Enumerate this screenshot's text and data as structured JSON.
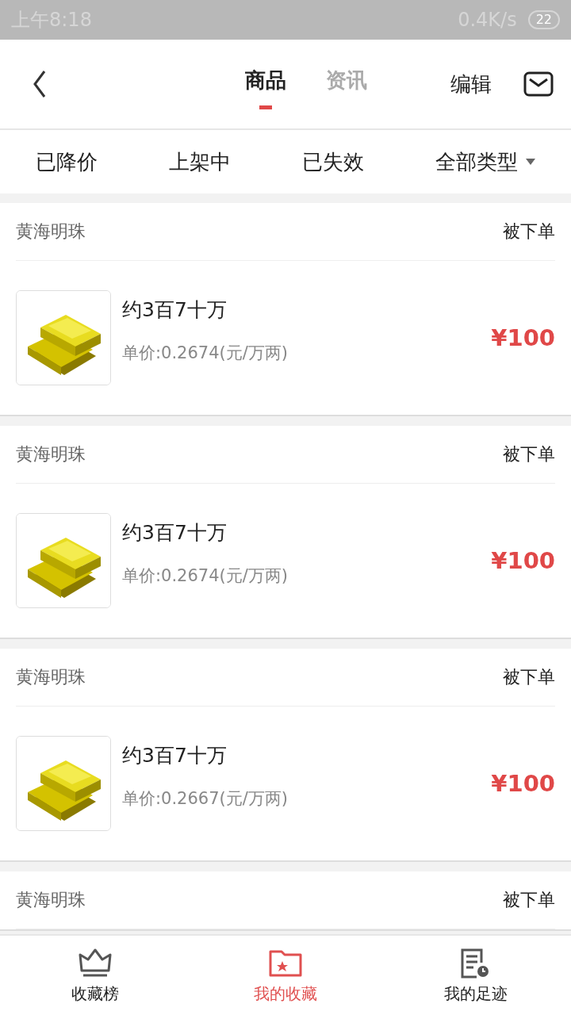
{
  "status_bar": {
    "time": "上午8:18",
    "speed": "0.4K/s",
    "battery": "22"
  },
  "header": {
    "tabs": [
      {
        "label": "商品",
        "selected": true
      },
      {
        "label": "资讯",
        "selected": false
      }
    ],
    "edit": "编辑"
  },
  "filters": [
    {
      "label": "已降价",
      "dropdown": false
    },
    {
      "label": "上架中",
      "dropdown": false
    },
    {
      "label": "已失效",
      "dropdown": false
    },
    {
      "label": "全部类型",
      "dropdown": true
    }
  ],
  "items": [
    {
      "seller": "黄海明珠",
      "status": "被下单",
      "title": "约3百7十万",
      "unit_price": "单价:0.2674(元/万两)",
      "price": "¥100"
    },
    {
      "seller": "黄海明珠",
      "status": "被下单",
      "title": "约3百7十万",
      "unit_price": "单价:0.2674(元/万两)",
      "price": "¥100"
    },
    {
      "seller": "黄海明珠",
      "status": "被下单",
      "title": "约3百7十万",
      "unit_price": "单价:0.2667(元/万两)",
      "price": "¥100"
    },
    {
      "seller": "黄海明珠",
      "status": "被下单"
    }
  ],
  "bottom_nav": [
    {
      "label": "收藏榜",
      "selected": false
    },
    {
      "label": "我的收藏",
      "selected": true
    },
    {
      "label": "我的足迹",
      "selected": false
    }
  ]
}
